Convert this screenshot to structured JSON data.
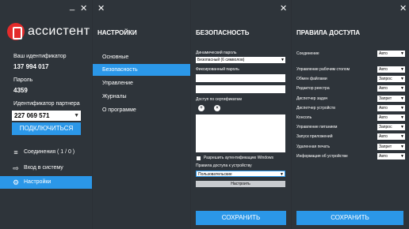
{
  "colors": {
    "accent": "#2b97e8",
    "panel_bg": "#2e343a",
    "brand_red": "#e42b2b"
  },
  "main": {
    "window_controls": {
      "minimize": "_",
      "close": "✕"
    },
    "brand": "ассистент",
    "id_label": "Ваш идентификатор",
    "id_value": "137 994 017",
    "password_label": "Пароль",
    "password_value": "4359",
    "partner_label": "Идентификатор партнера",
    "partner_value": "227 069 571",
    "connect_button": "ПОДКЛЮЧИТЬСЯ",
    "nav": [
      {
        "label": "Соединения ( 1 / 0 )",
        "icon": "connections-icon"
      },
      {
        "label": "Вход в систему",
        "icon": "login-icon"
      },
      {
        "label": "Настройки",
        "icon": "gear-icon"
      }
    ],
    "active_nav": 2
  },
  "settings": {
    "close": "✕",
    "title": "НАСТРОЙКИ",
    "items": [
      "Основные",
      "Безопасность",
      "Управление",
      "Журналы",
      "О программе"
    ],
    "active": 1
  },
  "security": {
    "close": "✕",
    "title": "БЕЗОПАСНОСТЬ",
    "dynamic_password_label": "Динамический пароль",
    "dynamic_password_value": "Безопасный (6 символов)",
    "fixed_password_label": "Фиксированный пароль",
    "cert_access_label": "Доступ по сертификатам",
    "add_symbol": "+",
    "remove_symbol": "×",
    "windows_auth_label": "Разрешить аутентификацию Windows",
    "access_rules_label": "Правила доступа к устройству",
    "access_rules_value": "Пользовательские",
    "configure_button": "Настроить",
    "save_button": "СОХРАНИТЬ"
  },
  "access_rules": {
    "close": "✕",
    "title": "ПРАВИЛА ДОСТУПА",
    "rows": [
      {
        "label": "Соединение",
        "value": "Авто"
      },
      {
        "label": "Управление рабочим столом",
        "value": "Авто"
      },
      {
        "label": "Обмен файлами",
        "value": "Запрос"
      },
      {
        "label": "Редактор реестра",
        "value": "Авто"
      },
      {
        "label": "Диспетчер задач",
        "value": "Запрет"
      },
      {
        "label": "Диспетчер устройств",
        "value": "Авто"
      },
      {
        "label": "Консоль",
        "value": "Авто"
      },
      {
        "label": "Управление питанием",
        "value": "Запрос"
      },
      {
        "label": "Запуск приложений",
        "value": "Авто"
      },
      {
        "label": "Удаленная печать",
        "value": "Запрет"
      },
      {
        "label": "Информация об устройстве",
        "value": "Авто"
      }
    ],
    "save_button": "СОХРАНИТЬ"
  }
}
